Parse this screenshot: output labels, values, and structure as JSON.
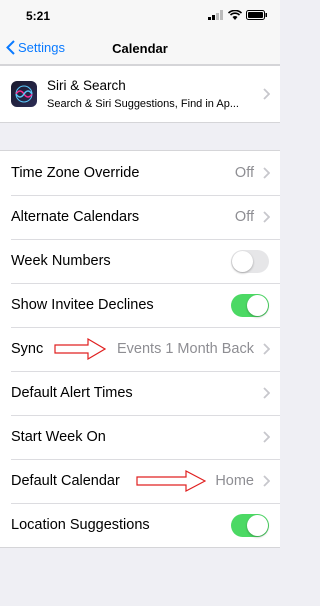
{
  "status": {
    "time": "5:21"
  },
  "nav": {
    "back_label": "Settings",
    "title": "Calendar"
  },
  "siri": {
    "title": "Siri & Search",
    "subtitle": "Search & Siri Suggestions, Find in Ap..."
  },
  "rows": {
    "time_zone_override": {
      "label": "Time Zone Override",
      "value": "Off"
    },
    "alternate_calendars": {
      "label": "Alternate Calendars",
      "value": "Off"
    },
    "week_numbers": {
      "label": "Week Numbers",
      "enabled": false
    },
    "show_invitee_declines": {
      "label": "Show Invitee Declines",
      "enabled": true
    },
    "sync": {
      "label": "Sync",
      "value": "Events 1 Month Back"
    },
    "default_alert_times": {
      "label": "Default Alert Times"
    },
    "start_week_on": {
      "label": "Start Week On"
    },
    "default_calendar": {
      "label": "Default Calendar",
      "value": "Home"
    },
    "location_suggestions": {
      "label": "Location Suggestions",
      "enabled": true
    }
  },
  "colors": {
    "accent": "#0a7aff",
    "toggle_on": "#4cd964",
    "annotation": "#e02020"
  }
}
